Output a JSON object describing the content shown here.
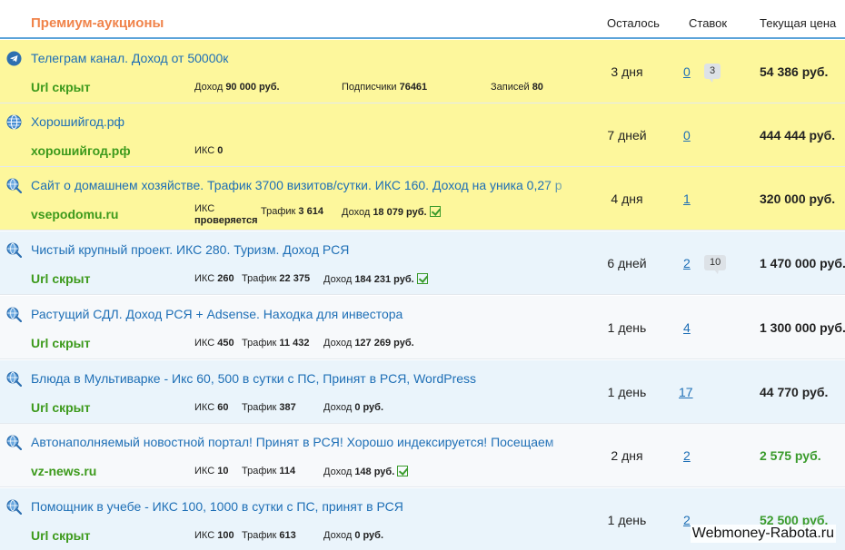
{
  "header": {
    "title": "Премиум-аукционы",
    "col_left": "Осталось",
    "col_bids": "Ставок",
    "col_price": "Текущая цена"
  },
  "rows": [
    {
      "icon": "telegram-icon",
      "name": "Телеграм канал. Доход от 50000к",
      "url": "Url скрыт",
      "m1_label": "Доход",
      "m1_value": "90 000 руб.",
      "m2_label": "Подписчики",
      "m2_value": "76461",
      "m3_label": "Записей",
      "m3_value": "80",
      "remain": "3 дня",
      "bids": "0",
      "bubble": "3",
      "price": "54 386 руб."
    },
    {
      "icon": "globe-icon",
      "name": "Хорошийгод.рф",
      "url": "хорошийгод.рф",
      "m1_label": "ИКС",
      "m1_value": "0",
      "remain": "7 дней",
      "bids": "0",
      "price": "444 444 руб."
    },
    {
      "icon": "site-search-icon",
      "name": "Сайт о домашнем хозяйстве. Трафик 3700 визитов/сутки. ИКС 160. Доход на уника 0,27 р",
      "url": "vsepodomu.ru",
      "m1_label": "ИКС",
      "m1_value": "проверяется",
      "m2_label": "Трафик",
      "m2_value": "3 614",
      "m3_label": "Доход",
      "m3_value": "18 079 руб.",
      "remain": "4 дня",
      "bids": "1",
      "price": "320 000 руб."
    },
    {
      "icon": "site-search-icon",
      "name": "Чистый крупный проект. ИКС 280. Туризм. Доход РСЯ",
      "url": "Url скрыт",
      "m1_label": "ИКС",
      "m1_value": "260",
      "m2_label": "Трафик",
      "m2_value": "22 375",
      "m3_label": "Доход",
      "m3_value": "184 231 руб.",
      "remain": "6 дней",
      "bids": "2",
      "bubble": "10",
      "price": "1 470 000 руб."
    },
    {
      "icon": "site-search-icon",
      "name": "Растущий СДЛ. Доход РСЯ + Adsense. Находка для инвестора",
      "url": "Url скрыт",
      "m1_label": "ИКС",
      "m1_value": "450",
      "m2_label": "Трафик",
      "m2_value": "11 432",
      "m3_label": "Доход",
      "m3_value": "127 269 руб.",
      "remain": "1 день",
      "bids": "4",
      "price": "1 300 000 руб."
    },
    {
      "icon": "site-search-icon",
      "name": "Блюда в Мультиварке - Икс 60, 500 в сутки с ПС, Принят в РСЯ, WordPress",
      "url": "Url скрыт",
      "m1_label": "ИКС",
      "m1_value": "60",
      "m2_label": "Трафик",
      "m2_value": "387",
      "m3_label": "Доход",
      "m3_value": "0 руб.",
      "remain": "1 день",
      "bids": "17",
      "price": "44 770 руб."
    },
    {
      "icon": "site-search-icon",
      "name": "Автонаполняемый новостной портал! Принят в РСЯ! Хорошо индексируется! Посещаем",
      "url": "vz-news.ru",
      "m1_label": "ИКС",
      "m1_value": "10",
      "m2_label": "Трафик",
      "m2_value": "114",
      "m3_label": "Доход",
      "m3_value": "148 руб.",
      "remain": "2 дня",
      "bids": "2",
      "price": "2 575 руб."
    },
    {
      "icon": "site-search-icon",
      "name": "Помощник в учебе - ИКС 100, 1000 в сутки с ПС, принят в РСЯ",
      "url": "Url скрыт",
      "m1_label": "ИКС",
      "m1_value": "100",
      "m2_label": "Трафик",
      "m2_value": "613",
      "m3_label": "Доход",
      "m3_value": "0 руб.",
      "remain": "1 день",
      "bids": "2",
      "price": "52 500 руб."
    }
  ],
  "watermark": "Webmoney-Rabota.ru",
  "colors": {
    "accent_orange": "#f0834a",
    "link_blue": "#1e6fb6",
    "url_green": "#3d9a1c",
    "row_highlight": "#fdf79c",
    "row_blue": "#eaf4fb",
    "header_border": "#5ba3d9"
  }
}
